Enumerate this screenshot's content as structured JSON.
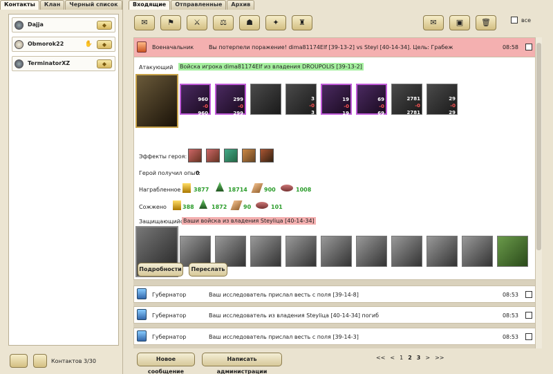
{
  "left_tabs": [
    "Контакты",
    "Клан",
    "Черный список"
  ],
  "contacts": [
    {
      "name": "Dajja",
      "status_icon": "gold-button-icon"
    },
    {
      "name": "Obmorok22",
      "status_icon": "gold-button-icon",
      "extra_icon": "handshake-icon"
    },
    {
      "name": "TerminatorXZ",
      "status_icon": "gold-button-icon"
    }
  ],
  "contacts_count": "Контактов 3/30",
  "right_tabs": [
    "Входящие",
    "Отправленные",
    "Архив"
  ],
  "toolbar": {
    "all_label": "все"
  },
  "messages": [
    {
      "from": "Военачальник",
      "subject": "Вы потерпели поражение! dima81174Elf [39-13-2] vs Steyl [40-14-34]. Цель: Грабеж",
      "time": "08:58",
      "highlight": true
    },
    {
      "from": "Губернатор",
      "subject": "Ваш исследователь прислал весть с поля [39-14-8]",
      "time": "08:53"
    },
    {
      "from": "Губернатор",
      "subject": "Ваш исследователь из владения Steyliца [40-14-34] погиб",
      "time": "08:53"
    },
    {
      "from": "Губернатор",
      "subject": "Ваш исследователь прислал весть с поля [39-14-3]",
      "time": "08:53"
    }
  ],
  "report": {
    "attacker_label": "Атакующий",
    "attacker_tag": "Войска игрока dima81174Elf из владения DROUPOLIS [39-13-2]",
    "attacker_units": [
      {
        "a": "960",
        "b": "-0",
        "c": "960"
      },
      {
        "a": "299",
        "b": "-0",
        "c": "299"
      },
      {
        "a": "",
        "b": "",
        "c": ""
      },
      {
        "a": "3",
        "b": "-0",
        "c": "3"
      },
      {
        "a": "19",
        "b": "-0",
        "c": "19"
      },
      {
        "a": "69",
        "b": "-0",
        "c": "69"
      },
      {
        "a": "2781",
        "b": "-0",
        "c": "2781"
      },
      {
        "a": "29",
        "b": "-0",
        "c": "29"
      }
    ],
    "effects_label": "Эффекты героя:",
    "exp_label": "Герой получил опыт:",
    "exp_value": "0",
    "looted_label": "Награбленное",
    "looted": [
      "3877",
      "18714",
      "900",
      "1008"
    ],
    "burned_label": "Сожжено",
    "burned": [
      "388",
      "1872",
      "90",
      "101"
    ],
    "defender_label": "Защищающийся",
    "defender_tag": "Ваши войска из владения Steyliца [40-14-34]",
    "details_btn": "Подробности",
    "forward_btn": "Переслать"
  },
  "bottom": {
    "new_msg": "Новое сообщение",
    "write_admin": "Написать администрации",
    "pagination": [
      "<<",
      "<",
      "1",
      "2",
      "3",
      ">",
      ">>"
    ],
    "current_page": "3"
  },
  "colors": {
    "accent_red": "#f4b0b0",
    "accent_green": "#a6f0a0",
    "gold": "#d8b860"
  }
}
